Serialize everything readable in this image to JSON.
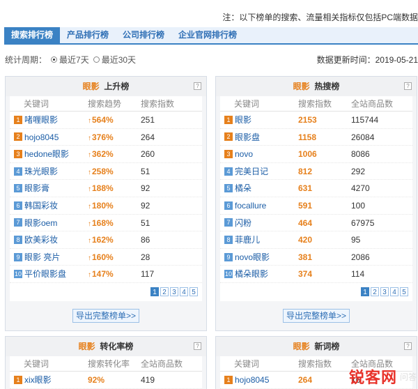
{
  "note": "注：以下榜单的搜索、流量相关指标仅包括PC端数据",
  "tabs": [
    {
      "label": "搜索排行榜",
      "active": true
    },
    {
      "label": "产品排行榜",
      "active": false
    },
    {
      "label": "公司排行榜",
      "active": false
    },
    {
      "label": "企业官网排行榜",
      "active": false
    }
  ],
  "period": {
    "label": "统计周期：",
    "options": [
      "最近7天",
      "最近30天"
    ],
    "selected": 0
  },
  "updated": "数据更新时间：2019-05-21",
  "panels": {
    "rising": {
      "hl": "眼影",
      "title": "上升榜",
      "help": "?",
      "cols": [
        "关键词",
        "搜索趋势",
        "搜索指数"
      ],
      "rows": [
        [
          "1",
          "啫喱眼影",
          "564%",
          "251"
        ],
        [
          "2",
          "hojo8045",
          "376%",
          "264"
        ],
        [
          "3",
          "hedone眼影",
          "362%",
          "260"
        ],
        [
          "4",
          "珠光眼影",
          "258%",
          "51"
        ],
        [
          "5",
          "眼影膏",
          "188%",
          "92"
        ],
        [
          "6",
          "韩国彩妆",
          "180%",
          "92"
        ],
        [
          "7",
          "眼影oem",
          "168%",
          "51"
        ],
        [
          "8",
          "欧美彩妆",
          "162%",
          "86"
        ],
        [
          "9",
          "眼影 亮片",
          "160%",
          "28"
        ],
        [
          "10",
          "平价眼影盘",
          "147%",
          "117"
        ]
      ],
      "pages": [
        "1",
        "2",
        "3",
        "4",
        "5"
      ],
      "export": "导出完整榜单>>"
    },
    "hot": {
      "hl": "眼影",
      "title": "热搜榜",
      "help": "?",
      "cols": [
        "关键词",
        "搜索指数",
        "全站商品数"
      ],
      "rows": [
        [
          "1",
          "眼影",
          "2153",
          "115744"
        ],
        [
          "2",
          "眼影盘",
          "1158",
          "26084"
        ],
        [
          "3",
          "novo",
          "1006",
          "8086"
        ],
        [
          "4",
          "完美日记",
          "812",
          "292"
        ],
        [
          "5",
          "橘朵",
          "631",
          "4270"
        ],
        [
          "6",
          "focallure",
          "591",
          "100"
        ],
        [
          "7",
          "闪粉",
          "464",
          "67975"
        ],
        [
          "8",
          "菲鹿儿",
          "420",
          "95"
        ],
        [
          "9",
          "novo眼影",
          "381",
          "2086"
        ],
        [
          "10",
          "橘朵眼影",
          "374",
          "114"
        ]
      ],
      "pages": [
        "1",
        "2",
        "3",
        "4",
        "5"
      ],
      "export": "导出完整榜单>>"
    },
    "conversion": {
      "hl": "眼影",
      "title": "转化率榜",
      "help": "?",
      "cols": [
        "关键词",
        "搜索转化率",
        "全站商品数"
      ],
      "rows": [
        [
          "1",
          "xix眼影",
          "92%",
          "419"
        ]
      ]
    },
    "newword": {
      "hl": "眼影",
      "title": "新词榜",
      "help": "?",
      "cols": [
        "关键词",
        "搜索指数",
        "全站商品数"
      ],
      "rows": [
        [
          "1",
          "hojo8045",
          "264",
          "16"
        ]
      ]
    }
  },
  "watermark": {
    "text": "锐客网",
    "sub": "问答"
  },
  "colors": {
    "accent": "#e6801c",
    "tab_active": "#3b82c4",
    "link": "#1b5da6"
  }
}
